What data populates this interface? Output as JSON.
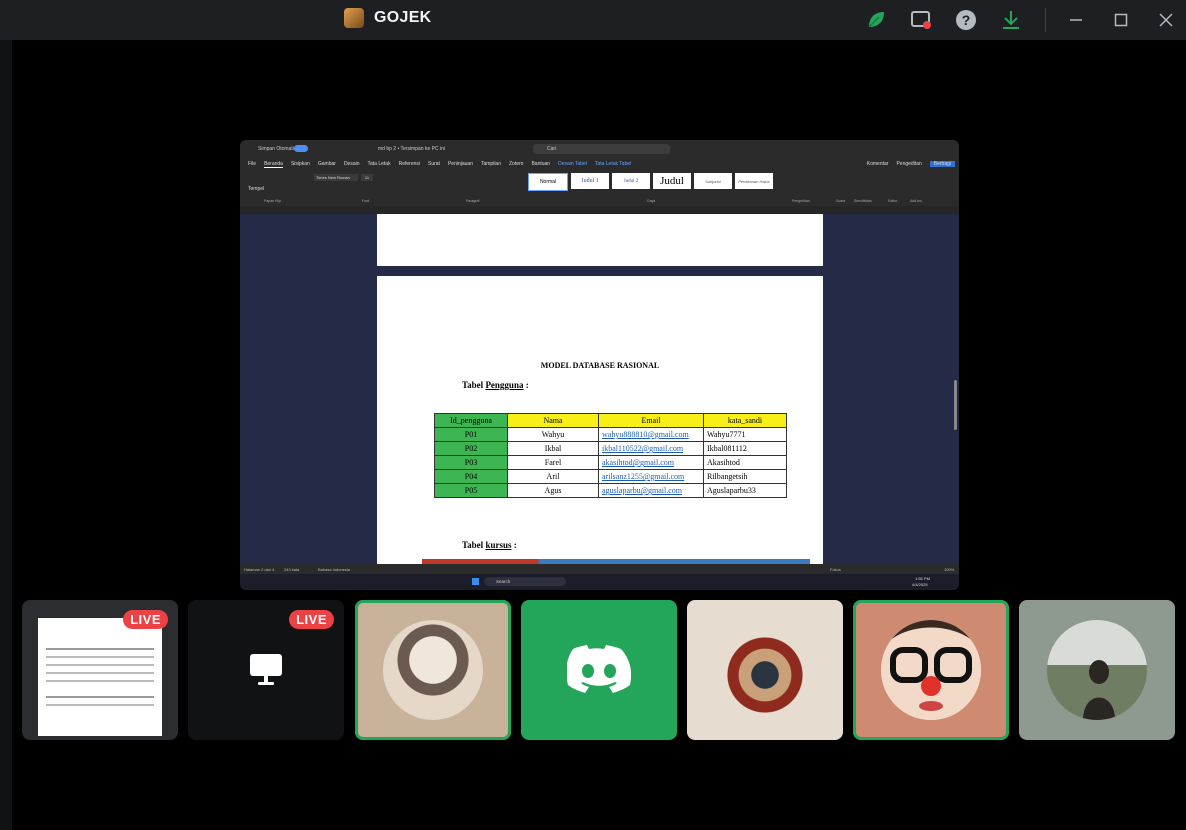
{
  "titlebar": {
    "app_name": "GOJEK",
    "icons": [
      "nitro-leaf-icon",
      "screen-record-icon",
      "help-icon",
      "download-icon",
      "minimize-icon",
      "maximize-icon",
      "close-icon"
    ],
    "colors": {
      "leaf": "#23a55a",
      "record_dot": "#ed4245",
      "download": "#23a55a"
    }
  },
  "word": {
    "title_bar": {
      "autosave": "Simpan Otomatis",
      "doc_name": "md bp 2 • Tersimpan ke PC ini",
      "search_placeholder": "Cari"
    },
    "menu": [
      "File",
      "Beranda",
      "Sisipkan",
      "Gambar",
      "Desain",
      "Tata Letak",
      "Referensi",
      "Surat",
      "Peninjauan",
      "Tampilan",
      "Zotero",
      "Bantuan",
      "Desain Tabel",
      "Tata Letak Tabel"
    ],
    "menu_right": {
      "comment": "Komentar",
      "editing": "Pengeditan",
      "share": "Berbagi"
    },
    "ribbon": {
      "font_name": "Times New Roman",
      "font_size": "11",
      "paste": "Tempel",
      "styles": [
        "Normal",
        "Judul 1",
        "Judul 2",
        "Judul",
        "Subjudul",
        "Penekanan Halus"
      ],
      "groups": [
        "Papan Klip",
        "Font",
        "Paragraf",
        "Gaya",
        "Pengeditan",
        "Suara",
        "Sensitivitas",
        "Editor",
        "Add-ins"
      ]
    },
    "document": {
      "heading": "MODEL DATABASE RASIONAL",
      "table1_label_prefix": "Tabel ",
      "table1_label_link": "Pengguna",
      "table1_label_suffix": " :",
      "table2_label_prefix": "Tabel ",
      "table2_label_link": "kursus",
      "table2_label_suffix": " :",
      "users_table": {
        "headers": [
          "Id_pengguna",
          "Nama",
          "Email",
          "kata_sandi"
        ],
        "rows": [
          [
            "P01",
            "Wahyu",
            "wahyu888810@gmail.com",
            "Wahyu7771"
          ],
          [
            "P02",
            "Ikbal",
            "ikbal110522@gmail.com",
            "Ikbal081112"
          ],
          [
            "P03",
            "Farel",
            "akasihtod@gmail.com",
            "Akasihtod"
          ],
          [
            "P04",
            "Aril",
            "arilsanz1255@gmail.com",
            "Rilbangetsih"
          ],
          [
            "P05",
            "Agus",
            "aguslaparbu@gmail.com",
            "Aguslaparbu33"
          ]
        ]
      }
    },
    "status": {
      "page": "Halaman 2 dari 4",
      "words": "243 kata",
      "language": "Bahasa Indonesia",
      "focus": "Fokus",
      "zoom": "100%"
    },
    "taskbar": {
      "search": "Search",
      "time": "1:55 PM",
      "date": "4/4/2025"
    }
  },
  "participants": [
    {
      "kind": "stream",
      "live": "LIVE"
    },
    {
      "kind": "stream",
      "live": "LIVE"
    },
    {
      "kind": "avatar",
      "speaking": true,
      "bg": "#c8b29a"
    },
    {
      "kind": "discord",
      "speaking": false,
      "bg": "#23a55a"
    },
    {
      "kind": "avatar",
      "speaking": false,
      "bg": "#e7dcd0"
    },
    {
      "kind": "avatar",
      "speaking": true,
      "bg": "#cf8a72"
    },
    {
      "kind": "avatar",
      "speaking": false,
      "bg": "#8e9a8f"
    }
  ]
}
